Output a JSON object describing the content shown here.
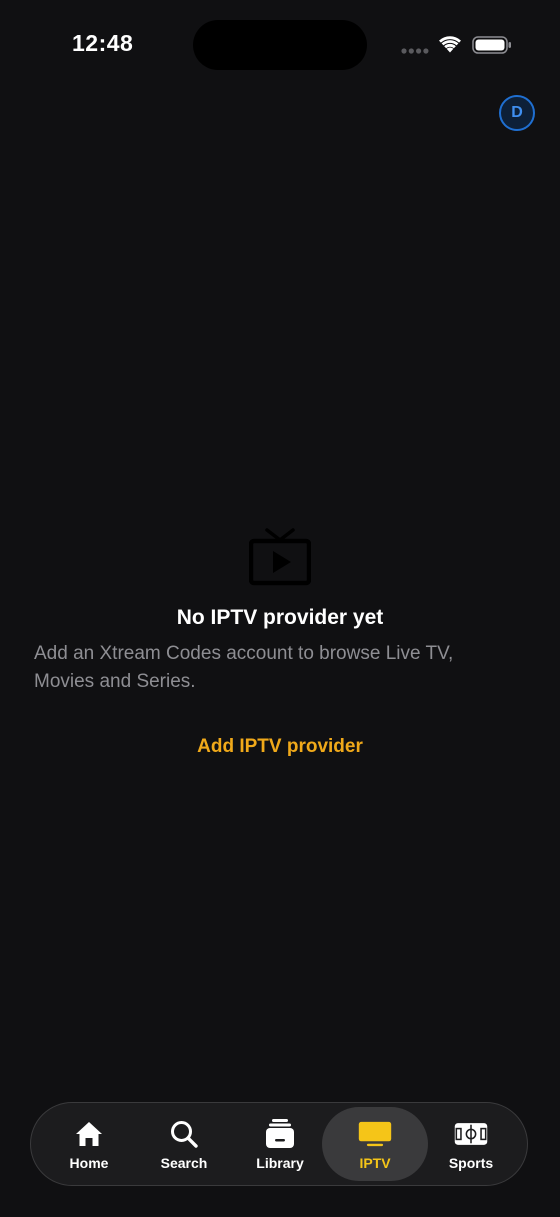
{
  "status_bar": {
    "time": "12:48"
  },
  "avatar": {
    "initial": "D",
    "color": "#1f6fd1"
  },
  "empty_state": {
    "icon": "tv-icon",
    "title": "No IPTV provider yet",
    "description": "Add an Xtream Codes account to browse Live TV, Movies and Series.",
    "action_label": "Add IPTV provider",
    "action_color": "#f0a91a"
  },
  "tab_bar": {
    "active_color": "#f5c518",
    "tabs": [
      {
        "label": "Home",
        "icon": "home-icon"
      },
      {
        "label": "Search",
        "icon": "search-icon"
      },
      {
        "label": "Library",
        "icon": "library-icon"
      },
      {
        "label": "IPTV",
        "icon": "tv-icon",
        "active": true
      },
      {
        "label": "Sports",
        "icon": "sports-field-icon"
      }
    ]
  }
}
